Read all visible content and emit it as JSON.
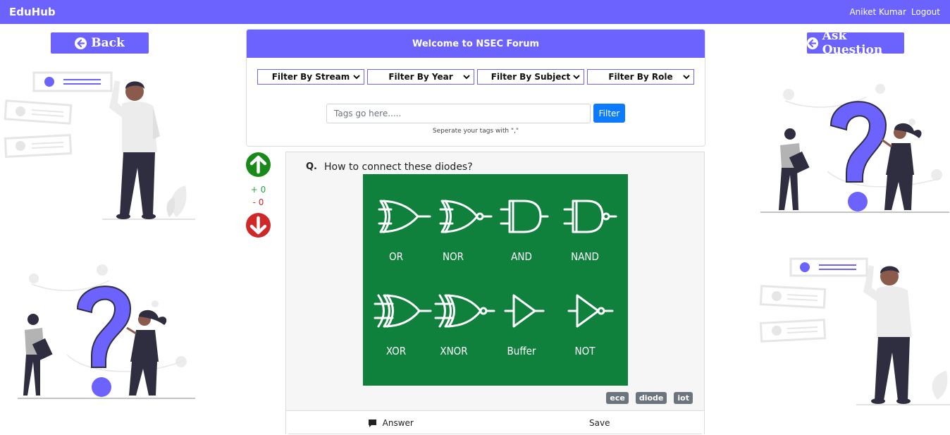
{
  "navbar": {
    "brand": "EduHub",
    "user_name": "Aniket Kumar",
    "logout_label": "Logout"
  },
  "back_button": {
    "label": "Back",
    "icon": "arrow-left-circle-icon"
  },
  "ask_button": {
    "label": "Ask Question",
    "icon": "arrow-left-circle-icon"
  },
  "forum": {
    "title": "Welcome to NSEC Forum",
    "filters": [
      {
        "label": "Filter By Stream"
      },
      {
        "label": "Filter By Year"
      },
      {
        "label": "Filter By Subject"
      },
      {
        "label": "Filter By Role"
      }
    ],
    "tags_placeholder": "Tags go here.....",
    "filter_button": "Filter",
    "hint": "Seperate your tags with \",\""
  },
  "votes": {
    "upvotes": "+ 0",
    "downvotes": "- 0"
  },
  "question": {
    "number": "Q.",
    "text": "How to connect these diodes?",
    "image_labels": [
      "OR",
      "NOR",
      "AND",
      "NAND",
      "XOR",
      "XNOR",
      "Buffer",
      "NOT"
    ],
    "tags": [
      "ece",
      "diode",
      "iot"
    ],
    "answer_label": "Answer",
    "save_label": "Save"
  },
  "colors": {
    "brand": "#6c63ff",
    "upvote": "#198a19",
    "downvote": "#d02828",
    "filter_button": "#0d7bff",
    "image_bg": "#0f813d"
  }
}
